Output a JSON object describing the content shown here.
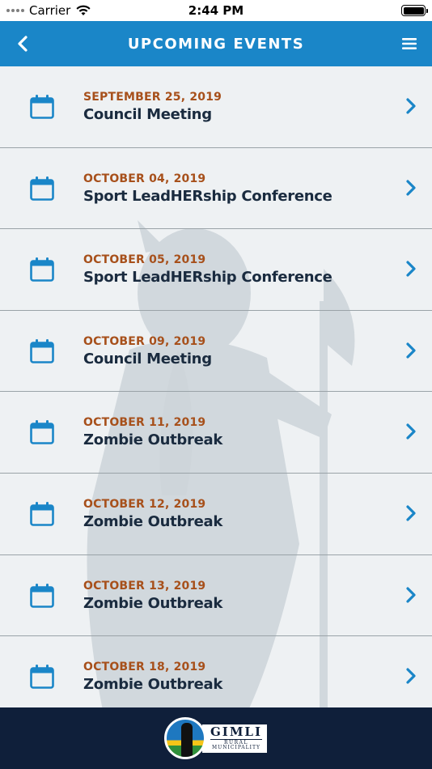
{
  "status_bar": {
    "carrier": "Carrier",
    "time": "2:44 PM"
  },
  "header": {
    "title": "UPCOMING EVENTS",
    "back_icon": "chevron-left-icon",
    "menu_icon": "hamburger-menu-icon"
  },
  "events": [
    {
      "date": "SEPTEMBER 25, 2019",
      "title": "Council Meeting"
    },
    {
      "date": "OCTOBER 04, 2019",
      "title": "Sport LeadHERship Conference"
    },
    {
      "date": "OCTOBER 05, 2019",
      "title": "Sport LeadHERship Conference"
    },
    {
      "date": "OCTOBER 09, 2019",
      "title": "Council Meeting"
    },
    {
      "date": "OCTOBER 11, 2019",
      "title": "Zombie Outbreak"
    },
    {
      "date": "OCTOBER 12, 2019",
      "title": "Zombie Outbreak"
    },
    {
      "date": "OCTOBER 13, 2019",
      "title": "Zombie Outbreak"
    },
    {
      "date": "OCTOBER 18, 2019",
      "title": "Zombie Outbreak"
    }
  ],
  "footer": {
    "logo_main": "GIMLI",
    "logo_sub": "RURAL",
    "logo_sub2": "MUNICIPALITY"
  },
  "colors": {
    "header_bg": "#1a86c8",
    "date_text": "#a7501b",
    "title_text": "#1a2b3f",
    "icon_blue": "#1a86c8",
    "footer_bg": "#0f1f3a"
  }
}
